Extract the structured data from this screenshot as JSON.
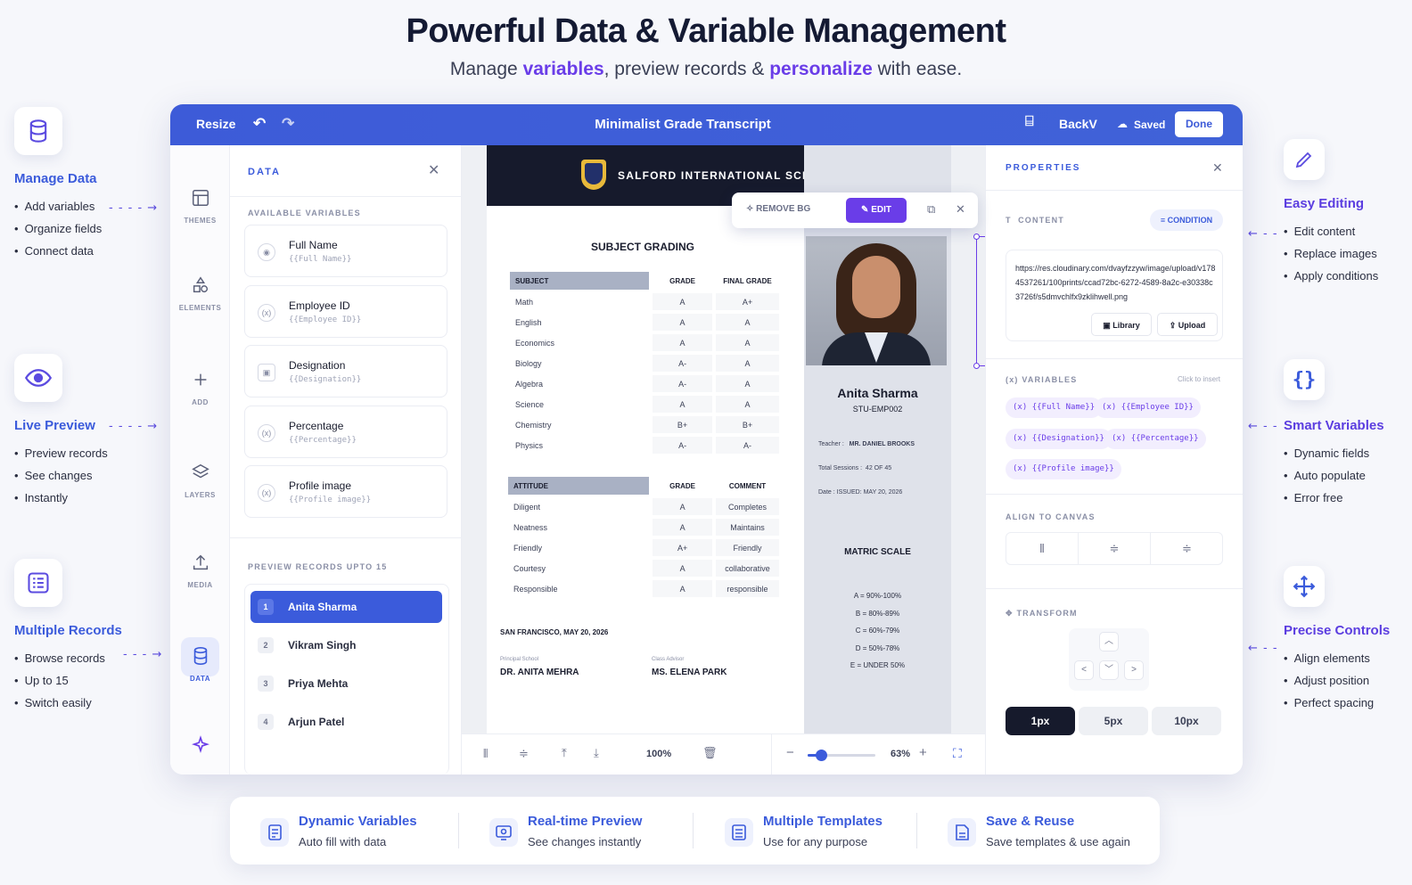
{
  "hero": {
    "title": "Powerful Data & Variable Management",
    "sub_1": "Manage ",
    "sub_hl_1": "variables",
    "sub_2": ", preview records & ",
    "sub_hl_2": "personalize",
    "sub_3": " with ease."
  },
  "left_features": [
    {
      "title": "Manage Data",
      "items": [
        "Add variables",
        "Organize fields",
        "Connect data"
      ]
    },
    {
      "title": "Live Preview",
      "items": [
        "Preview records",
        "See changes",
        "Instantly"
      ]
    },
    {
      "title": "Multiple Records",
      "items": [
        "Browse records",
        "Up to 15",
        "Switch easily"
      ]
    }
  ],
  "right_features": [
    {
      "title": "Easy Editing",
      "items": [
        "Edit content",
        "Replace images",
        "Apply conditions"
      ]
    },
    {
      "title": "Smart Variables",
      "items": [
        "Dynamic fields",
        "Auto populate",
        "Error free"
      ]
    },
    {
      "title": "Precise Controls",
      "items": [
        "Align elements",
        "Adjust position",
        "Perfect spacing"
      ]
    }
  ],
  "topbar": {
    "resize": "Resize",
    "title": "Minimalist Grade Transcript",
    "back": "BackV",
    "saved": "Saved",
    "done": "Done"
  },
  "rail": {
    "themes": "THEMES",
    "elements": "ELEMENTS",
    "add": "ADD",
    "layers": "LAYERS",
    "media": "MEDIA",
    "data": "DATA"
  },
  "data_panel": {
    "title": "DATA",
    "available_header": "AVAILABLE VARIABLES",
    "variables": [
      {
        "name": "Full Name",
        "token": "{{Full Name}}"
      },
      {
        "name": "Employee ID",
        "token": "{{Employee ID}}"
      },
      {
        "name": "Designation",
        "token": "{{Designation}}"
      },
      {
        "name": "Percentage",
        "token": "{{Percentage}}"
      },
      {
        "name": "Profile image",
        "token": "{{Profile image}}"
      }
    ],
    "records_header": "PREVIEW RECORDS UPTO 15",
    "records": [
      {
        "num": "1",
        "name": "Anita Sharma"
      },
      {
        "num": "2",
        "name": "Vikram Singh"
      },
      {
        "num": "3",
        "name": "Priya Mehta"
      },
      {
        "num": "4",
        "name": "Arjun Patel"
      }
    ]
  },
  "document": {
    "school": "SALFORD INTERNATIONAL SCHOOL",
    "grading_title": "SUBJECT GRADING",
    "subject_headers": [
      "SUBJECT",
      "GRADE",
      "FINAL GRADE"
    ],
    "subjects": [
      [
        "Math",
        "A",
        "A+"
      ],
      [
        "English",
        "A",
        "A"
      ],
      [
        "Economics",
        "A",
        "A"
      ],
      [
        "Biology",
        "A-",
        "A"
      ],
      [
        "Algebra",
        "A-",
        "A"
      ],
      [
        "Science",
        "A",
        "A"
      ],
      [
        "Chemistry",
        "B+",
        "B+"
      ],
      [
        "Physics",
        "A-",
        "A-"
      ]
    ],
    "attitude_headers": [
      "ATTITUDE",
      "GRADE",
      "COMMENT"
    ],
    "attitudes": [
      [
        "Diligent",
        "A",
        "Completes"
      ],
      [
        "Neatness",
        "A",
        "Maintains"
      ],
      [
        "Friendly",
        "A+",
        "Friendly"
      ],
      [
        "Courtesy",
        "A",
        "collaborative"
      ],
      [
        "Responsible",
        "A",
        "responsible"
      ]
    ],
    "place_date": "SAN FRANCISCO, MAY 20, 2026",
    "principal_label": "Principal School",
    "principal_name": "DR. ANITA MEHRA",
    "advisor_label": "Class Advisor",
    "advisor_name": "MS. ELENA PARK",
    "student_name": "Anita Sharma",
    "student_id": "STU-EMP002",
    "teacher_label": "Teacher :",
    "teacher_value": "MR. DANIEL BROOKS",
    "sessions_label": "Total Sessions :",
    "sessions_value": "42 OF 45",
    "date_label": "Date :",
    "date_value": "ISSUED: MAY 20, 2026",
    "matric_title": "MATRIC SCALE",
    "matric": [
      "A = 90%-100%",
      "B = 80%-89%",
      "C = 60%-79%",
      "D = 50%-78%",
      "E = UNDER 50%"
    ]
  },
  "float_toolbar": {
    "remove_bg": "REMOVE BG",
    "edit": "EDIT"
  },
  "canvas_bar": {
    "zoom_left": "100%",
    "zoom_right": "63%",
    "slider_fraction": 0.2
  },
  "properties": {
    "title": "PROPERTIES",
    "content_label": "CONTENT",
    "condition": "CONDITION",
    "url": "https://res.cloudinary.com/dvayfzzyw/image/upload/v1784537261/100prints/ccad72bc-6272-4589-8a2c-e30338c3726f/s5dmvchlfx9zklihwell.png",
    "library": "Library",
    "upload": "Upload",
    "variables_label": "VARIABLES",
    "click_insert": "Click to insert",
    "chips": [
      "{{Full Name}}",
      "{{Employee ID}}",
      "{{Designation}}",
      "{{Percentage}}",
      "{{Profile image}}"
    ],
    "align_label": "ALIGN TO CANVAS",
    "transform_label": "TRANSFORM",
    "steps": [
      "1px",
      "5px",
      "10px"
    ]
  },
  "footer": [
    {
      "title": "Dynamic Variables",
      "sub": "Auto fill with data"
    },
    {
      "title": "Real-time Preview",
      "sub": "See changes instantly"
    },
    {
      "title": "Multiple Templates",
      "sub": "Use for any purpose"
    },
    {
      "title": "Save & Reuse",
      "sub": "Save templates & use again"
    }
  ],
  "colors": {
    "accent": "#3b5bdb",
    "purple": "#6a3de8",
    "dark": "#161a2c"
  }
}
